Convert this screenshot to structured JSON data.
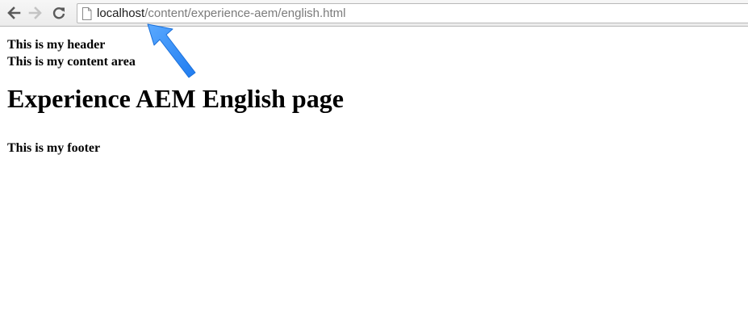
{
  "browser": {
    "address_bar": {
      "host": "localhost",
      "path": "/content/experience-aem/english.html"
    },
    "icons": {
      "back": "back-arrow-icon",
      "forward": "forward-arrow-icon",
      "reload": "reload-icon",
      "page": "page-icon"
    }
  },
  "page": {
    "header_text": "This is my header",
    "content_text": "This is my content area",
    "heading": "Experience AEM English page",
    "footer_text": "This is my footer"
  },
  "annotation": {
    "arrow_color": "#2f8ef4",
    "icon": "callout-arrow-icon"
  }
}
